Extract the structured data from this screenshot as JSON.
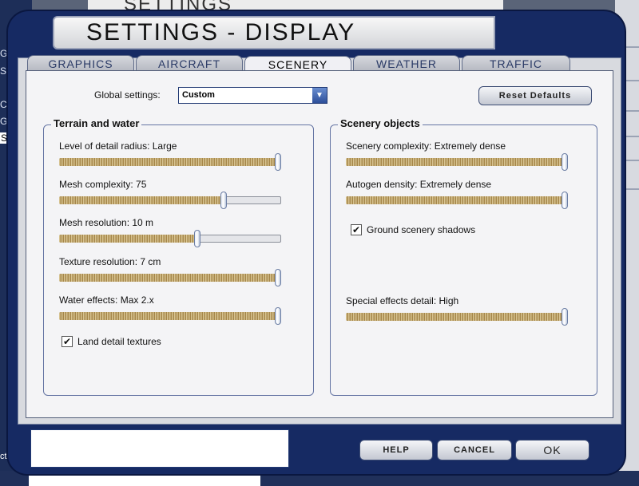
{
  "background": {
    "top_title": "SETTINGS",
    "left_fragments": [
      "G",
      "S",
      "C",
      "G",
      "S"
    ],
    "bottom_left_text": "cts"
  },
  "window": {
    "title": "SETTINGS - DISPLAY",
    "tabs": [
      "GRAPHICS",
      "AIRCRAFT",
      "SCENERY",
      "WEATHER",
      "TRAFFIC"
    ],
    "active_tab": "SCENERY"
  },
  "global_settings": {
    "label": "Global settings:",
    "value": "Custom"
  },
  "reset_defaults_label": "Reset Defaults",
  "terrain_group": {
    "title": "Terrain and water",
    "sliders": [
      {
        "label": "Level of detail radius: Large",
        "value": 1.0
      },
      {
        "label": "Mesh complexity: 75",
        "value": 0.75
      },
      {
        "label": "Mesh resolution: 10 m",
        "value": 0.63
      },
      {
        "label": "Texture resolution: 7 cm",
        "value": 1.0
      },
      {
        "label": "Water effects: Max 2.x",
        "value": 1.0
      }
    ],
    "checkbox": {
      "label": "Land detail textures",
      "checked": true
    }
  },
  "scenery_group": {
    "title": "Scenery objects",
    "sliders": [
      {
        "label": "Scenery complexity: Extremely dense",
        "value": 1.0
      },
      {
        "label": "Autogen density: Extremely dense",
        "value": 1.0
      }
    ],
    "checkbox": {
      "label": "Ground scenery shadows",
      "checked": true
    },
    "special_effects": {
      "label": "Special effects detail: High",
      "value": 1.0
    }
  },
  "footer": {
    "help": "HELP",
    "cancel": "CANCEL",
    "ok": "OK"
  },
  "colors": {
    "frame": "#162a63",
    "slider_fill": "#b89a58"
  }
}
